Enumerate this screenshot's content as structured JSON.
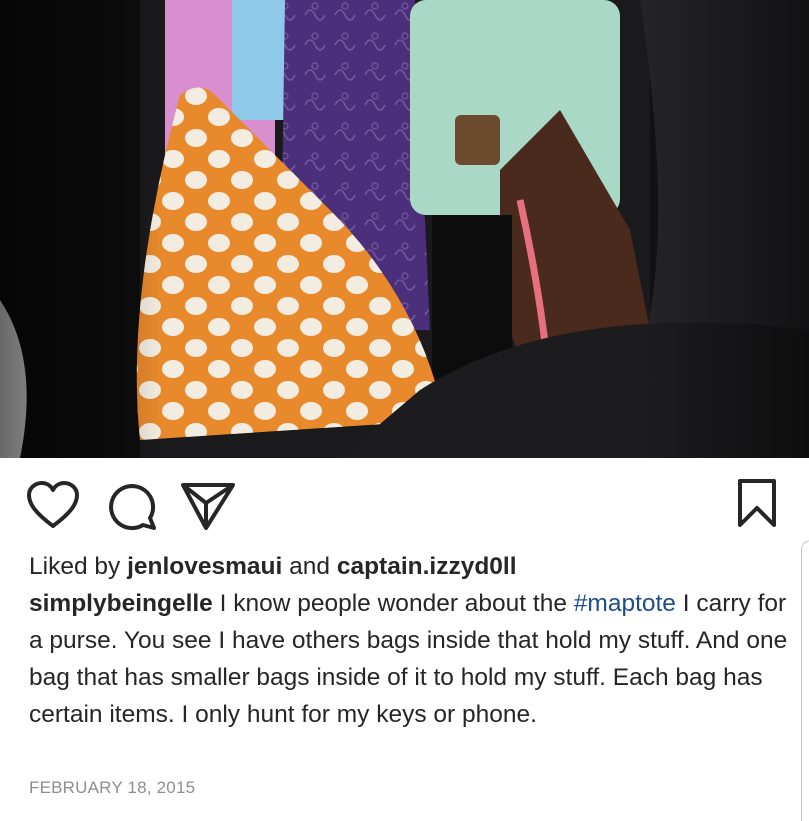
{
  "post": {
    "photo_alt": "Inside of a black tote bag holding several smaller pouches",
    "liked_by_prefix": "Liked by",
    "liked_by_users": [
      "jenlovesmaui",
      "captain.izzyd0ll"
    ],
    "liked_by_joiner": "and",
    "caption": {
      "username": "simplybeingelle",
      "text_before": "I know people wonder about the",
      "hashtag": "#maptote",
      "text_after": "I carry for a purse. You see I have others bags inside that hold my stuff. And one bag that has smaller bags inside of it to hold my stuff. Each bag has certain items. I only hunt for my keys or phone."
    },
    "timestamp": "FEBRUARY 18, 2015"
  },
  "icons": {
    "like": "heart-icon",
    "comment": "comment-bubble-icon",
    "share": "paper-plane-icon",
    "save": "bookmark-icon"
  },
  "colors": {
    "text": "#262626",
    "hashtag": "#1f4d8c",
    "timestamp": "#8e8e8e",
    "background": "#ffffff"
  }
}
